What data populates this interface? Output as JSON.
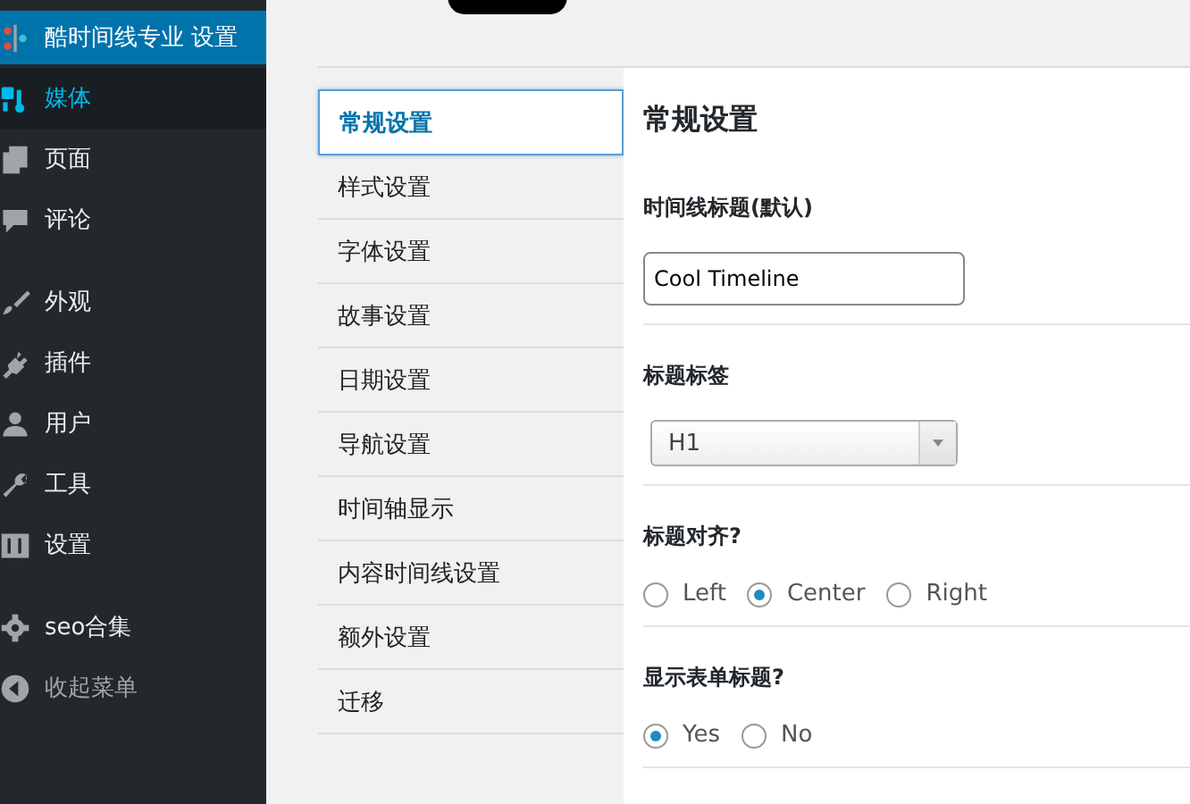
{
  "sidebar": {
    "groups": [
      {
        "items": [
          {
            "label": "酷时间线专业 设置",
            "kind": "timeline",
            "current": true,
            "hovered": false
          },
          {
            "label": "媒体",
            "kind": "media",
            "current": false,
            "hovered": true
          },
          {
            "label": "页面",
            "kind": "pages",
            "current": false,
            "hovered": false
          },
          {
            "label": "评论",
            "kind": "comments",
            "current": false,
            "hovered": false
          }
        ]
      },
      {
        "items": [
          {
            "label": "外观",
            "kind": "brush",
            "current": false,
            "hovered": false
          },
          {
            "label": "插件",
            "kind": "plug",
            "current": false,
            "hovered": false
          },
          {
            "label": "用户",
            "kind": "user",
            "current": false,
            "hovered": false
          },
          {
            "label": "工具",
            "kind": "wrench",
            "current": false,
            "hovered": false
          },
          {
            "label": "设置",
            "kind": "sliders",
            "current": false,
            "hovered": false
          }
        ]
      },
      {
        "items": [
          {
            "label": "seo合集",
            "kind": "gear",
            "current": false,
            "hovered": false
          },
          {
            "label": "收起菜单",
            "kind": "collapse",
            "current": false,
            "hovered": false
          }
        ]
      }
    ]
  },
  "tabs": [
    {
      "label": "常规设置",
      "selected": true
    },
    {
      "label": "样式设置",
      "selected": false
    },
    {
      "label": "字体设置",
      "selected": false
    },
    {
      "label": "故事设置",
      "selected": false
    },
    {
      "label": "日期设置",
      "selected": false
    },
    {
      "label": "导航设置",
      "selected": false
    },
    {
      "label": "时间轴显示",
      "selected": false
    },
    {
      "label": "内容时间线设置",
      "selected": false
    },
    {
      "label": "额外设置",
      "selected": false
    },
    {
      "label": "迁移",
      "selected": false
    }
  ],
  "panel": {
    "title": "常规设置",
    "fields": [
      {
        "kind": "text",
        "label": "时间线标题(默认)",
        "value": "Cool Timeline"
      },
      {
        "kind": "select",
        "label": "标题标签",
        "value": "H1"
      },
      {
        "kind": "radio",
        "label": "标题对齐?",
        "options": [
          {
            "label": "Left",
            "selected": false
          },
          {
            "label": "Center",
            "selected": true
          },
          {
            "label": "Right",
            "selected": false
          }
        ]
      },
      {
        "kind": "radio",
        "label": "显示表单标题?",
        "options": [
          {
            "label": "Yes",
            "selected": true
          },
          {
            "label": "No",
            "selected": false
          }
        ]
      }
    ]
  }
}
